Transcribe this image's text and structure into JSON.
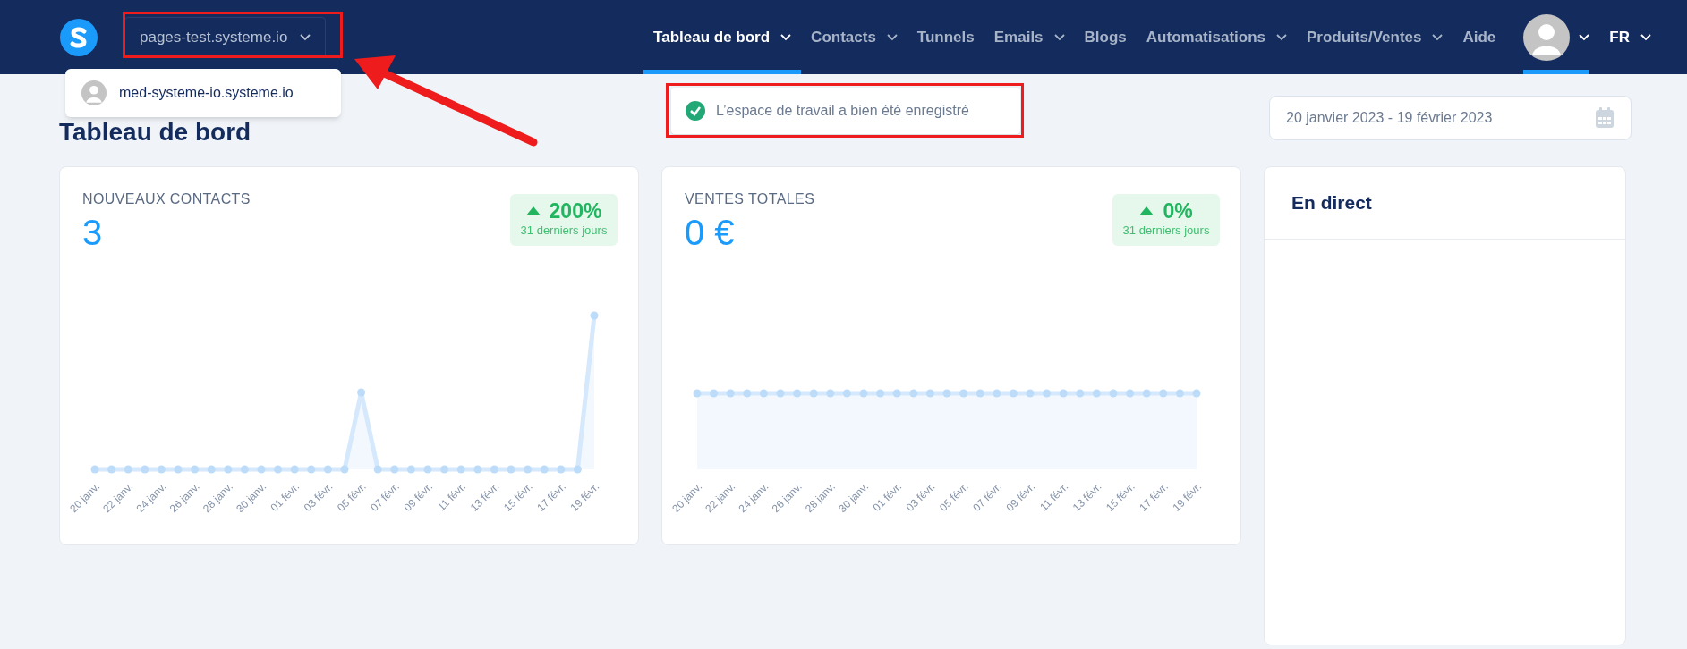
{
  "header": {
    "workspace": "pages-test.systeme.io",
    "nav": [
      {
        "label": "Tableau de bord",
        "dropdown": true,
        "selected": true
      },
      {
        "label": "Contacts",
        "dropdown": true,
        "selected": false
      },
      {
        "label": "Tunnels",
        "dropdown": false,
        "selected": false
      },
      {
        "label": "Emails",
        "dropdown": true,
        "selected": false
      },
      {
        "label": "Blogs",
        "dropdown": false,
        "selected": false
      },
      {
        "label": "Automatisations",
        "dropdown": true,
        "selected": false
      },
      {
        "label": "Produits/Ventes",
        "dropdown": true,
        "selected": false
      },
      {
        "label": "Aide",
        "dropdown": false,
        "selected": false
      }
    ],
    "account_menu": {
      "selected": true
    },
    "language": "FR"
  },
  "workspace_menu": {
    "items": [
      {
        "label": "med-systeme-io.systeme.io"
      }
    ]
  },
  "page_title": "Tableau de bord",
  "notification": "L’espace de travail a bien été enregistré",
  "date_range": "20 janvier 2023 - 19 février 2023",
  "cards": [
    {
      "title": "NOUVEAUX CONTACTS",
      "value": "3",
      "change": "200%",
      "period": "31 derniers jours",
      "kind": "peaks",
      "x_labels": [
        "20 janv.",
        "22 janv.",
        "24 janv.",
        "26 janv.",
        "28 janv.",
        "30 janv.",
        "01 févr.",
        "03 févr.",
        "05 févr.",
        "07 févr.",
        "09 févr.",
        "11 févr.",
        "13 févr.",
        "15 févr.",
        "17 févr.",
        "19 févr."
      ]
    },
    {
      "title": "VENTES TOTALES",
      "value": "0 €",
      "change": "0%",
      "period": "31 derniers jours",
      "kind": "flat",
      "x_labels": [
        "20 janv.",
        "22 janv.",
        "24 janv.",
        "26 janv.",
        "28 janv.",
        "30 janv.",
        "01 févr.",
        "03 févr.",
        "05 févr.",
        "07 févr.",
        "09 févr.",
        "11 févr.",
        "13 févr.",
        "15 févr.",
        "17 févr.",
        "19 févr."
      ]
    }
  ],
  "live_panel": {
    "title": "En direct"
  }
}
